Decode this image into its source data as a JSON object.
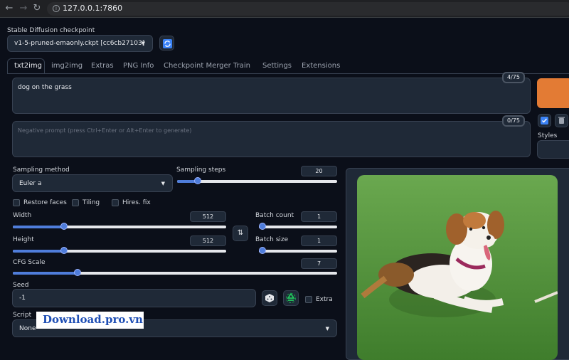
{
  "browser": {
    "url": "127.0.0.1:7860"
  },
  "checkpoint": {
    "label": "Stable Diffusion checkpoint",
    "value": "v1-5-pruned-emaonly.ckpt [cc6cb27103]"
  },
  "tabs": [
    "txt2img",
    "img2img",
    "Extras",
    "PNG Info",
    "Checkpoint Merger",
    "Train",
    "Settings",
    "Extensions"
  ],
  "prompt": {
    "value": "dog on the grass",
    "counter": "4/75"
  },
  "negative_prompt": {
    "placeholder": "Negative prompt (press Ctrl+Enter or Alt+Enter to generate)",
    "counter": "0/75"
  },
  "styles": {
    "label": "Styles"
  },
  "sampling": {
    "method_label": "Sampling method",
    "method_value": "Euler a",
    "steps_label": "Sampling steps",
    "steps_value": "20",
    "steps_fraction": 0.13
  },
  "checkboxes": {
    "restore_faces": "Restore faces",
    "tiling": "Tiling",
    "hires_fix": "Hires. fix"
  },
  "width": {
    "label": "Width",
    "value": "512",
    "fraction": 0.24
  },
  "height": {
    "label": "Height",
    "value": "512",
    "fraction": 0.24
  },
  "batch_count": {
    "label": "Batch count",
    "value": "1",
    "fraction": 0.0
  },
  "batch_size": {
    "label": "Batch size",
    "value": "1",
    "fraction": 0.0
  },
  "cfg": {
    "label": "CFG Scale",
    "value": "7",
    "fraction": 0.2
  },
  "seed": {
    "label": "Seed",
    "value": "-1",
    "extra_label": "Extra"
  },
  "script": {
    "label": "Script",
    "value": "None"
  },
  "watermark": {
    "text": "Download.pro.vn"
  },
  "colors": {
    "accent": "#4f7ddb",
    "generate": "#e37b34",
    "background": "#0b0f19"
  },
  "icons": [
    "back-arrow-icon",
    "forward-arrow-icon",
    "reload-icon",
    "refresh-icon",
    "swap-icon",
    "dice-icon",
    "recycle-icon",
    "trash-icon"
  ]
}
